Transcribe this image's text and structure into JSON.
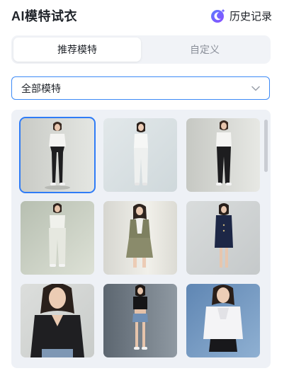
{
  "header": {
    "title": "AI模特试衣",
    "history_label": "历史记录",
    "history_icon": "moon-sparkle-icon"
  },
  "tabs": [
    {
      "label": "推荐模特",
      "active": true
    },
    {
      "label": "自定义",
      "active": false
    }
  ],
  "filter": {
    "selected": "全部模特",
    "icon": "chevron-down-icon"
  },
  "colors": {
    "accent": "#2f7cf6",
    "border_active": "#3d8af7",
    "panel": "#eef1f6"
  },
  "models": [
    {
      "name": "model-white-tee-black-leggings",
      "selected": true
    },
    {
      "name": "model-white-blouse-white-pants",
      "selected": false
    },
    {
      "name": "model-white-tee-black-leggings-2",
      "selected": false
    },
    {
      "name": "model-white-top-cargo-pants",
      "selected": false
    },
    {
      "name": "model-olive-vest-skirt",
      "selected": false
    },
    {
      "name": "model-navy-blazer-dress",
      "selected": false
    },
    {
      "name": "model-black-vneck-tee",
      "selected": false
    },
    {
      "name": "model-black-crop-denim-shorts",
      "selected": false
    },
    {
      "name": "model-white-ruffle-blouse",
      "selected": false
    }
  ]
}
